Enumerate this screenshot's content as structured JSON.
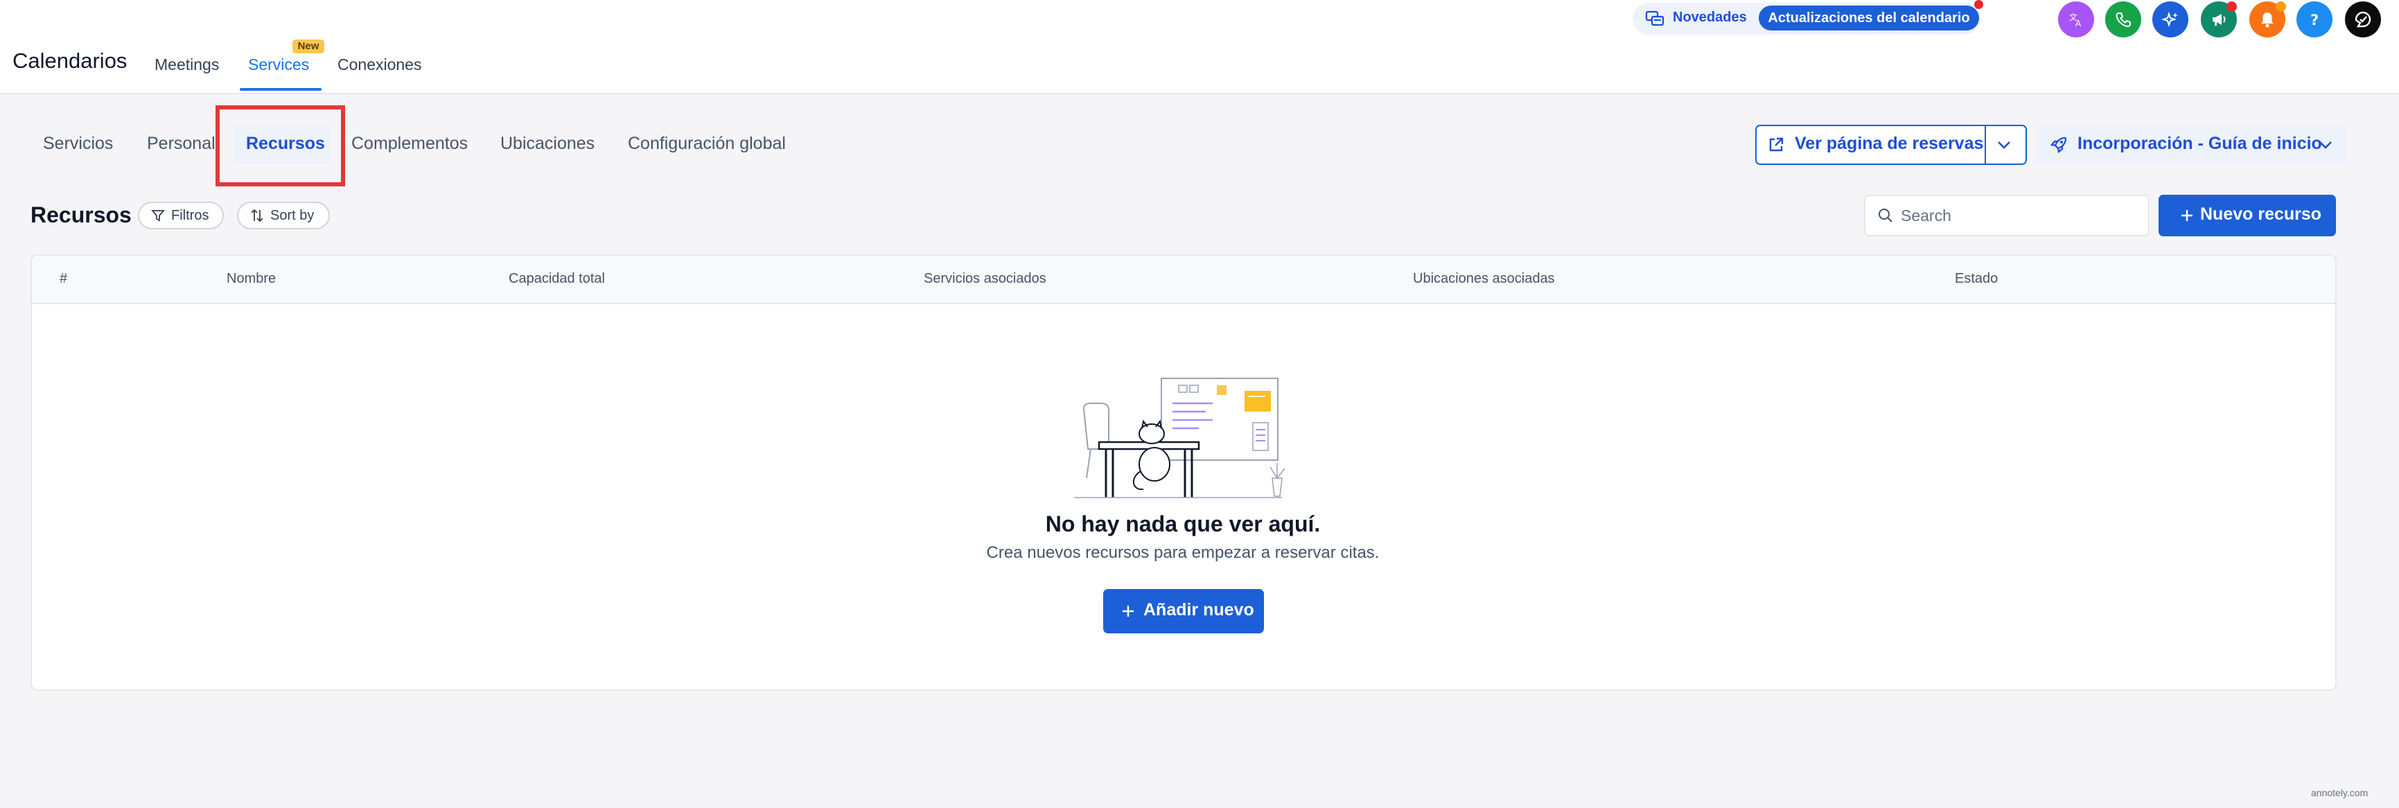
{
  "app": {
    "title": "Calendarios"
  },
  "top_nav": {
    "meetings": "Meetings",
    "services": "Services",
    "services_badge": "New",
    "connections": "Conexiones"
  },
  "updates": {
    "novedades": "Novedades",
    "calendar_updates": "Actualizaciones del calendario"
  },
  "header_icons": [
    "translate-icon",
    "phone-icon",
    "sparkle-icon",
    "megaphone-icon",
    "bell-icon",
    "help-icon",
    "profile-icon"
  ],
  "tabs": {
    "servicios": "Servicios",
    "personal": "Personal",
    "recursos": "Recursos",
    "complementos": "Complementos",
    "ubicaciones": "Ubicaciones",
    "configuracion": "Configuración global"
  },
  "actions": {
    "view_booking_page": "Ver página de reservas",
    "onboarding_guide": "Incorporación - Guía de inicio"
  },
  "section": {
    "title": "Recursos",
    "filters": "Filtros",
    "sort": "Sort by",
    "search_placeholder": "Search",
    "new_resource": "Nuevo recurso"
  },
  "table": {
    "columns": [
      "#",
      "Nombre",
      "Capacidad total",
      "Servicios asociados",
      "Ubicaciones asociadas",
      "Estado"
    ]
  },
  "empty_state": {
    "title": "No hay nada que ver aquí.",
    "subtitle": "Crea nuevos recursos para empezar a reservar citas.",
    "add_button": "Añadir nuevo"
  },
  "watermark": "annotely.com",
  "colors": {
    "accent": "#1d5fd6",
    "highlight": "#e03a3a",
    "badge": "#f9c74f"
  }
}
